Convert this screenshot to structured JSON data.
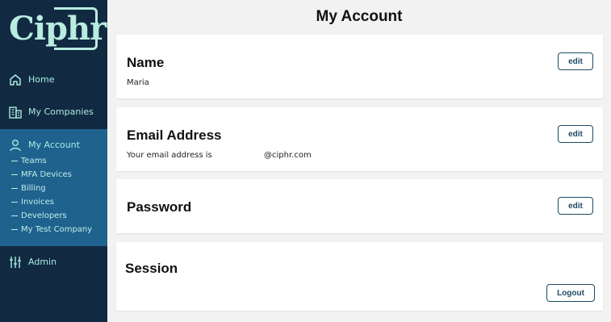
{
  "logo": {
    "text": "Ciphr"
  },
  "sidebar": {
    "items": [
      {
        "label": "Home",
        "icon": "home-icon"
      },
      {
        "label": "My Companies",
        "icon": "building-icon"
      },
      {
        "label": "My Account",
        "icon": "user-icon"
      },
      {
        "label": "Admin",
        "icon": "sliders-icon"
      }
    ],
    "sub_items": [
      "Teams",
      "MFA Devices",
      "Billing",
      "Invoices",
      "Developers",
      "My Test Company"
    ]
  },
  "page": {
    "title": "My Account"
  },
  "cards": {
    "name": {
      "title": "Name",
      "value": "Maria",
      "button": "edit"
    },
    "email": {
      "title": "Email Address",
      "prefix": "Your email address is",
      "domain": "@ciphr.com",
      "button": "edit"
    },
    "password": {
      "title": "Password",
      "button": "edit"
    },
    "session": {
      "title": "Session",
      "button": "Logout"
    }
  },
  "colors": {
    "sidebar_bg": "#112a42",
    "active_bg": "#20628e",
    "accent": "#a9ebe0",
    "button_border": "#1f4a63"
  }
}
